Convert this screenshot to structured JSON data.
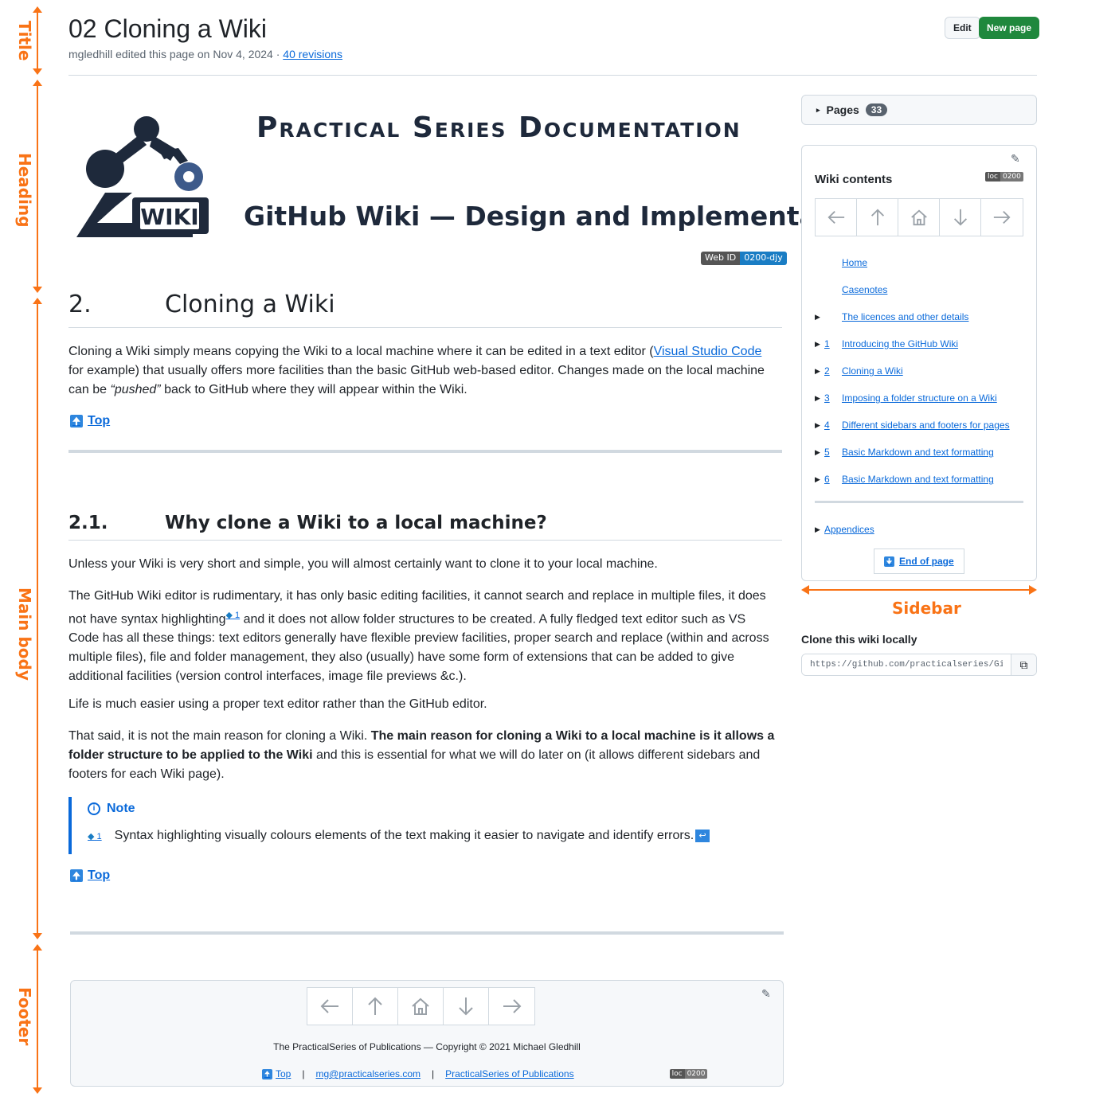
{
  "annotations": {
    "title": "Title",
    "heading": "Heading",
    "main_body": "Main body",
    "footer": "Footer",
    "sidebar": "Sidebar"
  },
  "header": {
    "title": "02 Cloning a Wiki",
    "meta_prefix": "mgledhill edited this page on Nov 4, 2024 · ",
    "revisions_link": "40 revisions",
    "edit_label": "Edit",
    "new_page_label": "New page"
  },
  "banner": {
    "series": "Practical Series Documentation",
    "logo_word": "WIKI",
    "subtitle": "GitHub Wiki — Design and Implementation",
    "web_id_key": "Web ID",
    "web_id_value": "0200-djy"
  },
  "main": {
    "section2": {
      "num": "2.",
      "title": "Cloning a Wiki"
    },
    "intro": {
      "before_link": "Cloning a Wiki simply means copying the Wiki to a local machine where it can be edited in a text editor (",
      "link": "Visual Studio Code",
      "after_link": " for example) that usually offers more facilities than the basic GitHub web-based editor. Changes made on the local machine can be ",
      "pushed": "“pushed”",
      "end": " back to GitHub where they will appear within the Wiki."
    },
    "top_label": "Top",
    "section21": {
      "num": "2.1.",
      "title": "Why clone a Wiki to a local machine?"
    },
    "p1": "Unless your Wiki is very short and simple, you will almost certainly want to clone it to your local machine.",
    "p2_a": "The GitHub Wiki editor is rudimentary, it has only basic editing facilities, it cannot search and replace in multiple files, it does not have syntax highlighting",
    "p2_fn": "1",
    "p2_b": " and it does not allow folder structures to be created. A fully fledged text editor such as VS Code has all these things: text editors generally have flexible preview facilities, proper search and replace (within and across multiple files), file and folder management, they also (usually) have some form of extensions that can be added to give additional facilities (version control interfaces, image file previews &c.).",
    "p3": "Life is much easier using a proper text editor rather than the GitHub editor.",
    "p4_a": "That said, it is not the main reason for cloning a Wiki. ",
    "p4_bold": "The main reason for cloning a Wiki to a local machine is it allows a folder structure to be applied to the Wiki",
    "p4_b": " and this is essential for what we will do later on (it allows different sidebars and footers for each Wiki page).",
    "note_title": "Note",
    "note_fn": "1",
    "note_text": "Syntax highlighting visually colours elements of the text making it easier to navigate and identify errors."
  },
  "footer": {
    "copyright": "The PracticalSeries of Publications — Copyright © 2021 Michael Gledhill",
    "top_label": "Top",
    "email": "mg@practicalseries.com",
    "publications": "PracticalSeries of Publications",
    "loc_key": "loc",
    "loc_value": "0200",
    "sep": "|"
  },
  "sidebar": {
    "pages_label": "Pages",
    "pages_count": "33",
    "wiki_contents": "Wiki contents",
    "loc_key": "loc",
    "loc_value": "0200",
    "toc": [
      {
        "num": "",
        "label": "Home",
        "expandable": false
      },
      {
        "num": "",
        "label": "Casenotes",
        "expandable": false
      },
      {
        "num": "",
        "label": "The licences and other details",
        "expandable": true
      },
      {
        "num": "1",
        "label": "Introducing the GitHub Wiki",
        "expandable": true
      },
      {
        "num": "2",
        "label": "Cloning a Wiki",
        "expandable": true
      },
      {
        "num": "3",
        "label": "Imposing a folder structure on a Wiki",
        "expandable": true
      },
      {
        "num": "4",
        "label": "Different sidebars and footers for pages",
        "expandable": true
      },
      {
        "num": "5",
        "label": "Basic Markdown and text formatting",
        "expandable": true
      },
      {
        "num": "6",
        "label": "Basic Markdown and text formatting",
        "expandable": true
      }
    ],
    "appendices": "Appendices",
    "end_of_page": "End of page",
    "clone_title": "Clone this wiki locally",
    "clone_url": "https://github.com/practicalseries/GitHub-Wiki-Design-and-Implementation.wiki.git"
  },
  "colors": {
    "annotation": "#f97316",
    "link": "#0969da",
    "primary_button": "#1f883d",
    "banner_text": "#1e293b"
  },
  "icons": {
    "nav": [
      "arrow-left-icon",
      "arrow-up-icon",
      "home-icon",
      "arrow-down-icon",
      "arrow-right-icon"
    ],
    "pencil": "pencil-icon",
    "copy": "copy-icon",
    "info": "info-icon"
  }
}
